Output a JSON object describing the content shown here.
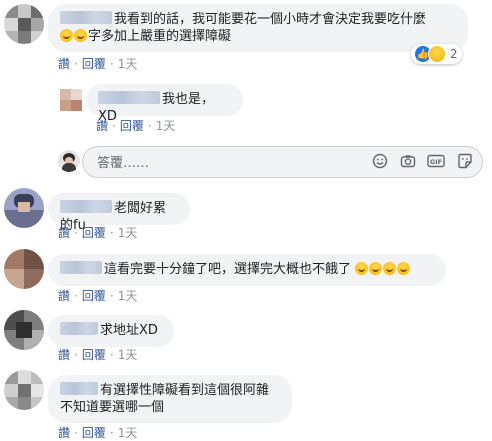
{
  "actions": {
    "like": "讚",
    "reply": "回覆",
    "separator": "·"
  },
  "comments": [
    {
      "text_line1": "我看到的話，我可能要花一個小時才會決定我要吃什麼",
      "text_line2": "字多加上嚴重的選擇障礙",
      "time": "1天",
      "reaction_count": "2"
    },
    {
      "text": "我也是，XD",
      "time": "1天"
    },
    {
      "text": "老闆好累的fu",
      "time": "1天"
    },
    {
      "text": "這看完要十分鐘了吧，選擇完大概也不餓了",
      "time": "1天"
    },
    {
      "text": "求地址XD",
      "time": "1天"
    },
    {
      "text_line1": "有選擇性障礙看到這個很阿雜",
      "text_line2": "不知道要選哪一個",
      "time": "1天"
    }
  ],
  "reply_box": {
    "placeholder": "答覆……"
  },
  "reply_tools": [
    "emoji-icon",
    "camera-icon",
    "gif-icon",
    "sticker-icon"
  ],
  "colors": {
    "link": "#385898",
    "meta": "#90949c",
    "bubble": "#f2f3f5",
    "like_blue": "#1877f2"
  }
}
